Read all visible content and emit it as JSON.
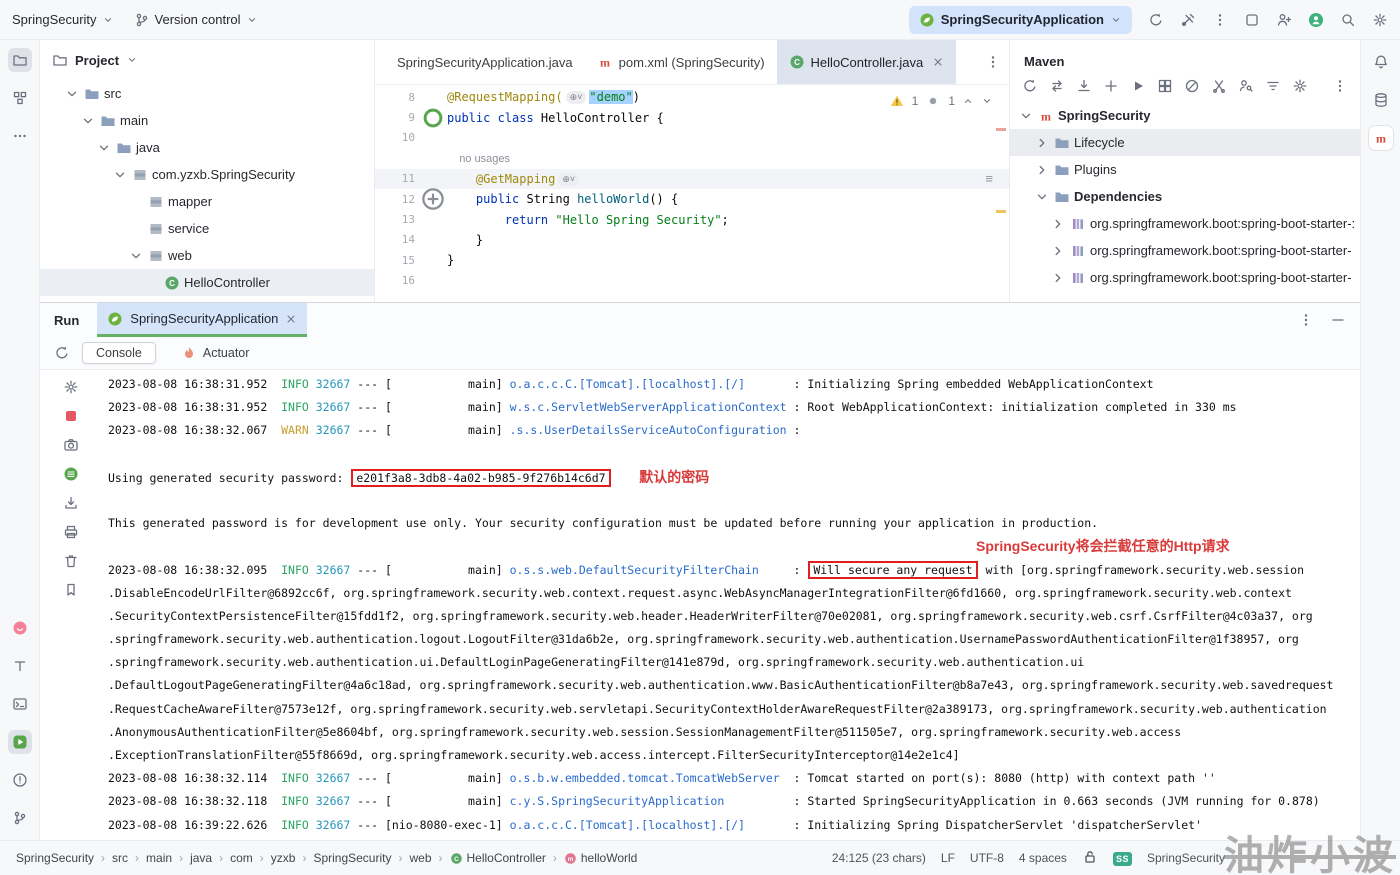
{
  "colors": {
    "accent": "#3574f0",
    "run_green": "#65b168",
    "annotation_red": "#e02020",
    "info_green": "#2ba562",
    "warn_yellow": "#c99f2e",
    "selection_blue": "#a6d2ff"
  },
  "topbar": {
    "project_name": "SpringSecurity",
    "version_control": "Version control",
    "run_config": "SpringSecurityApplication",
    "right_icons": [
      {
        "k": "refresh",
        "n": "rerun"
      },
      {
        "k": "tools",
        "n": "build-tools"
      },
      {
        "k": "kebab",
        "n": "more-actions"
      },
      {
        "k": "window",
        "n": "tool-window-layout"
      },
      {
        "k": "userplus",
        "n": "code-with-me"
      },
      {
        "k": "avatar",
        "n": "user-avatar"
      },
      {
        "k": "search",
        "n": "search-everywhere"
      },
      {
        "k": "gear",
        "n": "settings"
      }
    ]
  },
  "left_strip": {
    "top": [
      {
        "k": "projecttool",
        "n": "project-tool",
        "a": 1
      },
      {
        "k": "structure",
        "n": "structure-tool"
      },
      {
        "k": "more",
        "n": "more-tool-windows"
      }
    ],
    "bottom": [
      {
        "k": "heart",
        "n": "heart"
      },
      {
        "k": "texttool",
        "n": "text-tool"
      },
      {
        "k": "terminal",
        "n": "terminal-tool"
      },
      {
        "k": "rungreen",
        "n": "run-tool",
        "a": 1
      },
      {
        "k": "problems",
        "n": "problems-tool"
      },
      {
        "k": "branch",
        "n": "version-control-tool"
      }
    ]
  },
  "right_strip": {
    "icons": [
      {
        "k": "bell",
        "n": "notifications-bell"
      },
      {
        "k": "database",
        "n": "database-tool"
      },
      {
        "k": "mavenm",
        "n": "maven-tool",
        "a": 1
      }
    ]
  },
  "project_panel": {
    "title": "Project",
    "tree": [
      {
        "label": "src",
        "icon": "folder",
        "level": 0,
        "chevron": "open"
      },
      {
        "label": "main",
        "icon": "folder",
        "level": 1,
        "chevron": "open"
      },
      {
        "label": "java",
        "icon": "folder",
        "level": 2,
        "chevron": "open"
      },
      {
        "label": "com.yzxb.SpringSecurity",
        "icon": "package",
        "level": 3,
        "chevron": "open"
      },
      {
        "label": "mapper",
        "icon": "package",
        "level": 4,
        "chevron": "none"
      },
      {
        "label": "service",
        "icon": "package",
        "level": 4,
        "chevron": "none"
      },
      {
        "label": "web",
        "icon": "package",
        "level": 4,
        "chevron": "open"
      },
      {
        "label": "HelloController",
        "icon": "class",
        "level": 5,
        "chevron": "none",
        "selected": true
      }
    ]
  },
  "editor": {
    "tabs": [
      {
        "label": "SpringSecurityApplication.java",
        "icon": null,
        "active": false,
        "closable": false
      },
      {
        "label": "pom.xml (SpringSecurity)",
        "icon": "mavenm",
        "active": false,
        "closable": false
      },
      {
        "label": "HelloController.java",
        "icon": "class",
        "active": true,
        "closable": true
      }
    ],
    "inspection": {
      "warnings": "1",
      "info": "1"
    },
    "lines": [
      {
        "num": "8",
        "segs": [
          {
            "t": "@RequestMapping(",
            "c": "ann"
          },
          {
            "t": "⊕˅",
            "c": "inlay"
          },
          {
            "t": "\"demo\"",
            "c": "str sel"
          },
          {
            "t": ")",
            "c": ""
          }
        ]
      },
      {
        "num": "9",
        "gutter": "bean",
        "segs": [
          {
            "t": "public class ",
            "c": "kw"
          },
          {
            "t": "HelloController",
            "c": ""
          },
          {
            "t": " {",
            "c": ""
          }
        ]
      },
      {
        "num": "10",
        "segs": []
      },
      {
        "hint": true,
        "segs": [
          {
            "t": "    no usages",
            "c": "hint"
          }
        ]
      },
      {
        "num": "11",
        "hl": true,
        "segs": [
          {
            "t": "    ",
            "c": ""
          },
          {
            "t": "@GetMapping",
            "c": "ann"
          },
          {
            "t": "⊕˅",
            "c": "inlay"
          }
        ]
      },
      {
        "num": "12",
        "gutter": "plusgut",
        "segs": [
          {
            "t": "    ",
            "c": ""
          },
          {
            "t": "public ",
            "c": "kw"
          },
          {
            "t": "String ",
            "c": ""
          },
          {
            "t": "helloWorld",
            "c": "method"
          },
          {
            "t": "() {",
            "c": ""
          }
        ]
      },
      {
        "num": "13",
        "segs": [
          {
            "t": "        ",
            "c": ""
          },
          {
            "t": "return ",
            "c": "kw"
          },
          {
            "t": "\"Hello Spring Security\"",
            "c": "str"
          },
          {
            "t": ";",
            "c": ""
          }
        ]
      },
      {
        "num": "14",
        "segs": [
          {
            "t": "    }",
            "c": ""
          }
        ]
      },
      {
        "num": "15",
        "segs": [
          {
            "t": "}",
            "c": ""
          }
        ]
      },
      {
        "num": "16",
        "segs": []
      }
    ]
  },
  "maven_panel": {
    "title": "Maven",
    "toolbar": [
      {
        "k": "refresh",
        "n": "reload-maven"
      },
      {
        "k": "swap",
        "n": "generate-sources"
      },
      {
        "k": "download",
        "n": "download-sources"
      },
      {
        "k": "plus",
        "n": "add-maven-project"
      },
      {
        "k": "play",
        "n": "execute-goal"
      },
      {
        "k": "grid",
        "n": "profiles"
      },
      {
        "k": "offline",
        "n": "offline-mode"
      },
      {
        "k": "cut",
        "n": "skip-tests"
      },
      {
        "k": "userkey",
        "n": "credentials"
      },
      {
        "k": "filter",
        "n": "filter"
      },
      {
        "k": "gear",
        "n": "maven-settings"
      },
      {
        "k": "kebab",
        "n": "maven-more"
      }
    ],
    "tree": [
      {
        "label": "SpringSecurity",
        "icon": "mavenm",
        "level": 0,
        "chevron": "open",
        "bold": true
      },
      {
        "label": "Lifecycle",
        "icon": "lifecycle",
        "level": 1,
        "chevron": "closed",
        "hover": true
      },
      {
        "label": "Plugins",
        "icon": "plugins",
        "level": 1,
        "chevron": "closed"
      },
      {
        "label": "Dependencies",
        "icon": "deps",
        "level": 1,
        "chevron": "open",
        "bold": true
      },
      {
        "label": "org.springframework.boot:spring-boot-starter-:",
        "icon": "library",
        "level": 2,
        "chevron": "closed"
      },
      {
        "label": "org.springframework.boot:spring-boot-starter-",
        "icon": "library",
        "level": 2,
        "chevron": "closed"
      },
      {
        "label": "org.springframework.boot:spring-boot-starter-",
        "icon": "library",
        "level": 2,
        "chevron": "closed"
      }
    ]
  },
  "run_panel": {
    "label": "Run",
    "tab": "SpringSecurityApplication",
    "tabs": [
      {
        "label": "Console",
        "active": true
      },
      {
        "label": "Actuator",
        "active": false
      }
    ],
    "toolbar": [
      {
        "k": "gear",
        "n": "console-settings"
      },
      {
        "k": "stopred",
        "n": "stop"
      },
      {
        "k": "camera",
        "n": "thread-dump"
      },
      {
        "k": "resume",
        "n": "resume"
      },
      {
        "k": "importicon",
        "n": "import"
      },
      {
        "k": "printer",
        "n": "print"
      },
      {
        "k": "trash",
        "n": "clear-all"
      },
      {
        "k": "pin",
        "n": "pin"
      }
    ],
    "console": {
      "rows": [
        {
          "s": [
            {
              "t": "2023-08-08 16:38:31.952  "
            },
            {
              "t": "INFO",
              "c": "i"
            },
            {
              "t": " "
            },
            {
              "t": "32667",
              "c": "d"
            },
            {
              "t": " --- [           main] "
            },
            {
              "t": "o.a.c.c.C.[Tomcat].[localhost].[/]",
              "c": "l"
            },
            {
              "t": "       : Initializing Spring embedded WebApplicationContext"
            }
          ]
        },
        {
          "s": [
            {
              "t": "2023-08-08 16:38:31.952  "
            },
            {
              "t": "INFO",
              "c": "i"
            },
            {
              "t": " "
            },
            {
              "t": "32667",
              "c": "d"
            },
            {
              "t": " --- [           main] "
            },
            {
              "t": "w.s.c.ServletWebServerApplicationContext",
              "c": "l"
            },
            {
              "t": " : Root WebApplicationContext: initialization completed in 330 ms"
            }
          ]
        },
        {
          "s": [
            {
              "t": "2023-08-08 16:38:32.067  "
            },
            {
              "t": "WARN",
              "c": "w"
            },
            {
              "t": " "
            },
            {
              "t": "32667",
              "c": "d"
            },
            {
              "t": " --- [           main] "
            },
            {
              "t": ".s.s.UserDetailsServiceAutoConfiguration",
              "c": "l"
            },
            {
              "t": " : "
            }
          ]
        },
        {
          "s": []
        },
        {
          "s": [
            {
              "t": "Using generated security password: "
            },
            {
              "t": "e201f3a8-3db8-4a02-b985-9f276b14c6d7",
              "c": "b"
            },
            {
              "t": "    "
            },
            {
              "t": "默认的密码",
              "c": "a"
            }
          ]
        },
        {
          "s": []
        },
        {
          "s": [
            {
              "t": "This generated password is for development use only. Your security configuration must be updated before running your application in production."
            }
          ]
        },
        {
          "s": [
            {
              "t": "SpringSecurity将会拦截任意的Http请求",
              "c": "a a2"
            }
          ]
        },
        {
          "s": [
            {
              "t": "2023-08-08 16:38:32.095  "
            },
            {
              "t": "INFO",
              "c": "i"
            },
            {
              "t": " "
            },
            {
              "t": "32667",
              "c": "d"
            },
            {
              "t": " --- [           main] "
            },
            {
              "t": "o.s.s.web.DefaultSecurityFilterChain",
              "c": "l"
            },
            {
              "t": "     : "
            },
            {
              "t": "Will secure any request",
              "c": "b"
            },
            {
              "t": " with [org.springframework.security.web.session"
            }
          ]
        },
        {
          "s": [
            {
              "t": ".DisableEncodeUrlFilter@6892cc6f, org.springframework.security.web.context.request.async.WebAsyncManagerIntegrationFilter@6fd1660, org.springframework.security.web.context"
            }
          ]
        },
        {
          "s": [
            {
              "t": ".SecurityContextPersistenceFilter@15fdd1f2, org.springframework.security.web.header.HeaderWriterFilter@70e02081, org.springframework.security.web.csrf.CsrfFilter@4c03a37, org"
            }
          ]
        },
        {
          "s": [
            {
              "t": ".springframework.security.web.authentication.logout.LogoutFilter@31da6b2e, org.springframework.security.web.authentication.UsernamePasswordAuthenticationFilter@1f38957, org"
            }
          ]
        },
        {
          "s": [
            {
              "t": ".springframework.security.web.authentication.ui.DefaultLoginPageGeneratingFilter@141e879d, org.springframework.security.web.authentication.ui"
            }
          ]
        },
        {
          "s": [
            {
              "t": ".DefaultLogoutPageGeneratingFilter@4a6c18ad, org.springframework.security.web.authentication.www.BasicAuthenticationFilter@b8a7e43, org.springframework.security.web.savedrequest"
            }
          ]
        },
        {
          "s": [
            {
              "t": ".RequestCacheAwareFilter@7573e12f, org.springframework.security.web.servletapi.SecurityContextHolderAwareRequestFilter@2a389173, org.springframework.security.web.authentication"
            }
          ]
        },
        {
          "s": [
            {
              "t": ".AnonymousAuthenticationFilter@5e8604bf, org.springframework.security.web.session.SessionManagementFilter@511505e7, org.springframework.security.web.access"
            }
          ]
        },
        {
          "s": [
            {
              "t": ".ExceptionTranslationFilter@55f8669d, org.springframework.security.web.access.intercept.FilterSecurityInterceptor@14e2e1c4]"
            }
          ]
        },
        {
          "s": [
            {
              "t": "2023-08-08 16:38:32.114  "
            },
            {
              "t": "INFO",
              "c": "i"
            },
            {
              "t": " "
            },
            {
              "t": "32667",
              "c": "d"
            },
            {
              "t": " --- [           main] "
            },
            {
              "t": "o.s.b.w.embedded.tomcat.TomcatWebServer",
              "c": "l"
            },
            {
              "t": "  : Tomcat started on port(s): 8080 (http) with context path ''"
            }
          ]
        },
        {
          "s": [
            {
              "t": "2023-08-08 16:38:32.118  "
            },
            {
              "t": "INFO",
              "c": "i"
            },
            {
              "t": " "
            },
            {
              "t": "32667",
              "c": "d"
            },
            {
              "t": " --- [           main] "
            },
            {
              "t": "c.y.S.SpringSecurityApplication",
              "c": "l"
            },
            {
              "t": "          : Started SpringSecurityApplication in 0.663 seconds (JVM running for 0.878)"
            }
          ]
        },
        {
          "s": [
            {
              "t": "2023-08-08 16:39:22.626  "
            },
            {
              "t": "INFO",
              "c": "i"
            },
            {
              "t": " "
            },
            {
              "t": "32667",
              "c": "d"
            },
            {
              "t": " --- [nio-8080-exec-1] "
            },
            {
              "t": "o.a.c.c.C.[Tomcat].[localhost].[/]",
              "c": "l"
            },
            {
              "t": "       : Initializing Spring DispatcherServlet 'dispatcherServlet'"
            }
          ]
        }
      ]
    }
  },
  "statusbar": {
    "breadcrumb": [
      {
        "label": "SpringSecurity"
      },
      {
        "label": "src"
      },
      {
        "label": "main"
      },
      {
        "label": "java"
      },
      {
        "label": "com"
      },
      {
        "label": "yzxb"
      },
      {
        "label": "SpringSecurity"
      },
      {
        "label": "web"
      },
      {
        "label": "HelloController",
        "icon": "class"
      },
      {
        "label": "helloWorld",
        "icon": "method"
      }
    ],
    "stats": [
      {
        "label": "24:125 (23 chars)"
      },
      {
        "label": "LF"
      },
      {
        "label": "UTF-8"
      },
      {
        "label": "4 spaces"
      },
      {
        "icon": "lock"
      },
      {
        "badge": "SS"
      },
      {
        "label": "SpringSecurity"
      }
    ]
  },
  "watermark": "油炸小波"
}
